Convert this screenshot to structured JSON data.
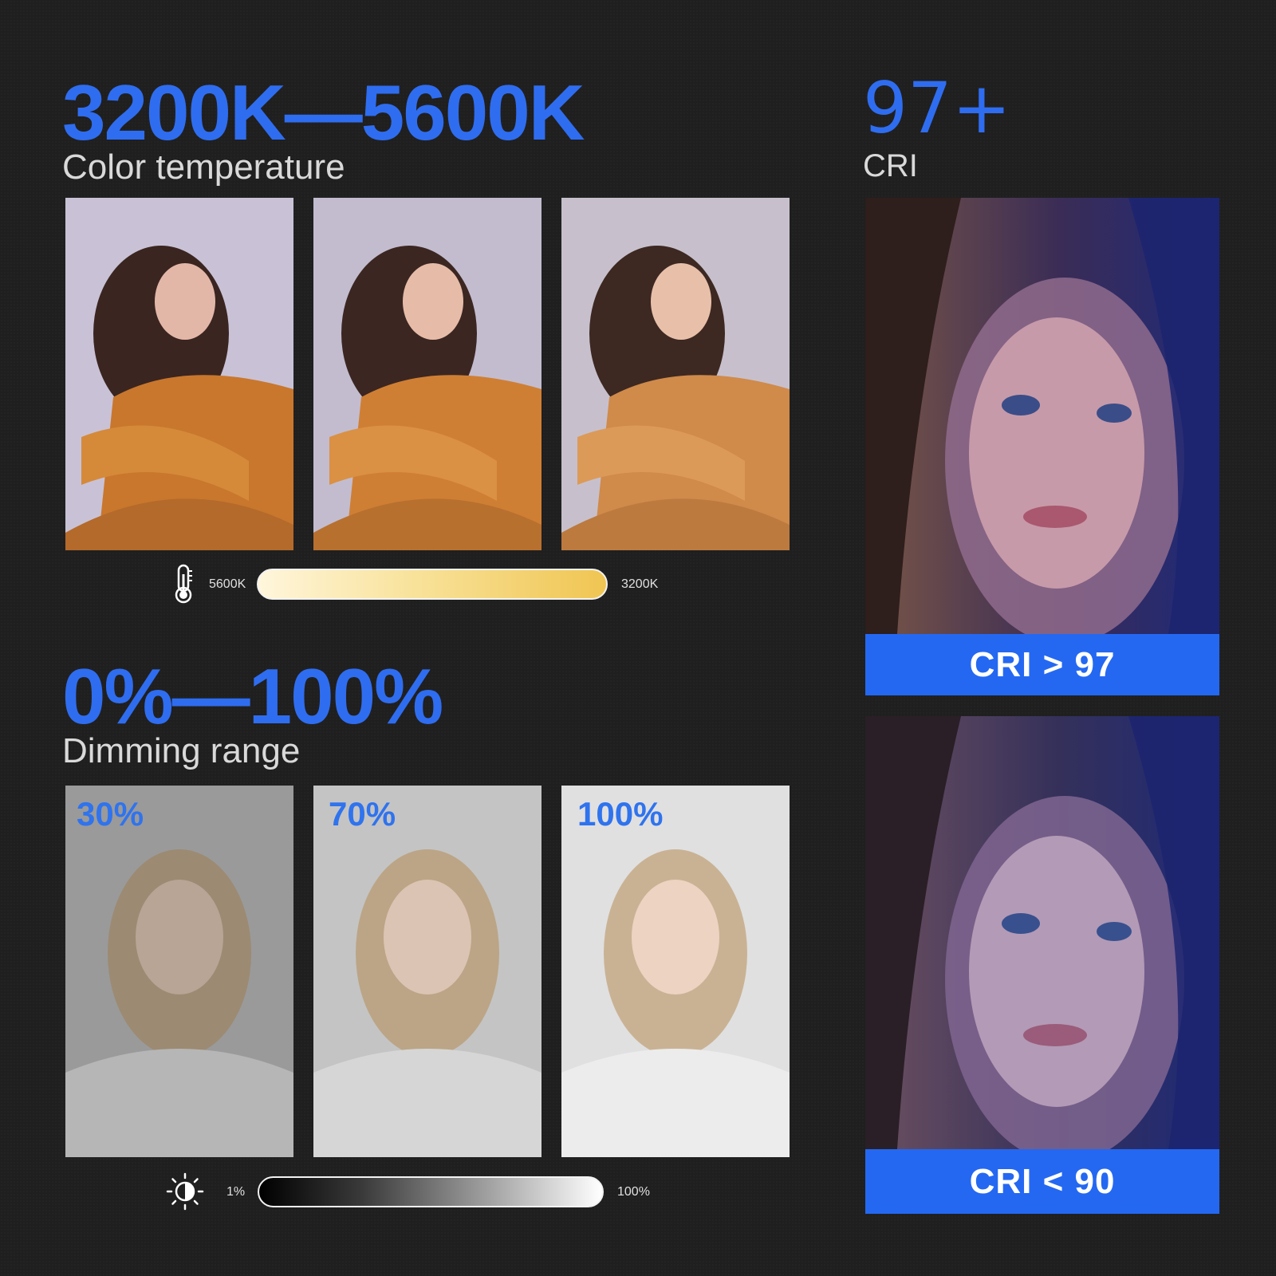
{
  "color_temp": {
    "heading": "3200K—5600K",
    "subheading": "Color temperature",
    "slider": {
      "min_label": "5600K",
      "max_label": "3200K",
      "icon": "thermometer-icon"
    }
  },
  "cri": {
    "heading": "97+",
    "subheading": "CRI",
    "top_banner": "CRI > 97",
    "bottom_banner": "CRI < 90"
  },
  "dimming": {
    "heading": "0%—100%",
    "subheading": "Dimming range",
    "levels": [
      {
        "label": "30%"
      },
      {
        "label": "70%"
      },
      {
        "label": "100%"
      }
    ],
    "slider": {
      "min_label": "1%",
      "max_label": "100%",
      "icon": "brightness-icon"
    }
  },
  "colors": {
    "accent": "#2f6df0",
    "banner": "#2468f2",
    "background": "#1f1f1f"
  }
}
